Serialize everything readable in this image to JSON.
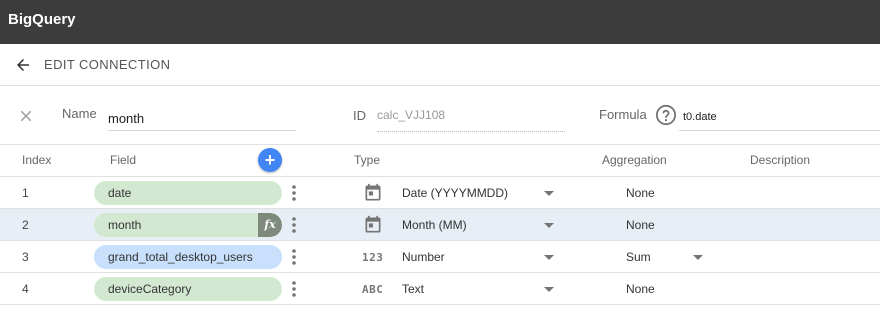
{
  "app": {
    "title": "BigQuery"
  },
  "subheader": {
    "title": "EDIT CONNECTION"
  },
  "form": {
    "name_label": "Name",
    "name_value": "month",
    "id_label": "ID",
    "id_value": "calc_VJJ108",
    "formula_label": "Formula",
    "formula_value": "t0.date"
  },
  "table": {
    "headers": {
      "index": "Index",
      "field": "Field",
      "type": "Type",
      "aggregation": "Aggregation",
      "description": "Description"
    },
    "add_label": "+",
    "rows": [
      {
        "index": "1",
        "field": "date",
        "field_color": "#d2e8d1",
        "type_icon": "calendar-icon",
        "type": "Date (YYYYMMDD)",
        "aggregation": "None",
        "selected": false,
        "calculated": false
      },
      {
        "index": "2",
        "field": "month",
        "field_color": "#d2e8d1",
        "type_icon": "calendar-icon",
        "type": "Month (MM)",
        "aggregation": "None",
        "selected": true,
        "calculated": true,
        "fx_label": "fx"
      },
      {
        "index": "3",
        "field": "grand_total_desktop_users",
        "field_color": "#c8e0fb",
        "type_icon": "number-icon",
        "type_icon_text": "123",
        "type": "Number",
        "aggregation": "Sum",
        "selected": false,
        "calculated": false
      },
      {
        "index": "4",
        "field": "deviceCategory",
        "field_color": "#d2e8d1",
        "type_icon": "text-icon",
        "type_icon_text": "ABC",
        "type": "Text",
        "aggregation": "None",
        "selected": false,
        "calculated": false
      }
    ]
  },
  "colors": {
    "topbar": "#3c3c3c",
    "add_button": "#4285f4",
    "dimension_chip": "#d2e8d1",
    "metric_chip": "#c8e0fb",
    "selected_row": "#e8eef5"
  }
}
